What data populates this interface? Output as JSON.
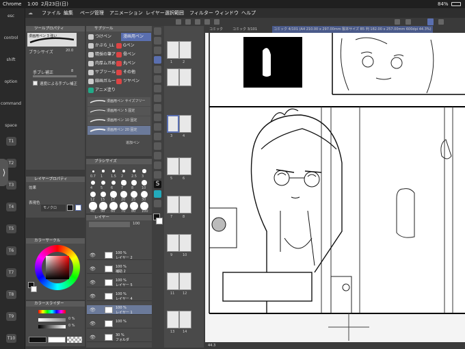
{
  "status": {
    "app": "Chrome",
    "time": "1:00",
    "date": "2月23日(日)",
    "battery": "84%"
  },
  "menu": [
    "ファイル",
    "編集",
    "ページ管理",
    "アニメーション",
    "レイヤー",
    "選択範囲",
    "フィルター",
    "ウィンドウ",
    "ヘルプ"
  ],
  "sidebar": {
    "keys": [
      "esc",
      "control",
      "shift",
      "option",
      "command",
      "space"
    ],
    "tbuttons": [
      "T1",
      "T2",
      "T3",
      "T4",
      "T5",
      "T6",
      "T7",
      "T8",
      "T9",
      "T10"
    ]
  },
  "tool_property": {
    "title": "ツールプロパティ",
    "tool_name": "漫画用ペン 3 強い",
    "brush_size_label": "ブラシサイズ",
    "brush_size_value": "20.0",
    "stabilization_label": "手ブレ補正",
    "stabilization_value": "8",
    "speed_label": "速度による手ブレ補正"
  },
  "layer_property": {
    "title": "レイヤープロパティ",
    "effect_label": "効果",
    "expression_label": "表現色",
    "expression_value": "モノクロ"
  },
  "color_circle": {
    "title": "カラーサークル"
  },
  "color_slider": {
    "title": "カラースライダー",
    "v1": "0 %",
    "v2": "0 %",
    "v3": "0 %"
  },
  "subtool": {
    "title": "サブツール",
    "groups": [
      {
        "left": "つけペン",
        "right": "漫画用ペン"
      },
      {
        "left": "かぶら_LL",
        "right": "Gペン"
      },
      {
        "left": "精採の筆ア",
        "right": "骨ペン"
      },
      {
        "left": "肉厚ムガめ",
        "right": "丸ペン"
      },
      {
        "left": "サブツール",
        "right": "その他"
      },
      {
        "left": "線画ガルー",
        "right": "ツヤペン"
      },
      {
        "left": "アニメ塗り",
        "right": ""
      }
    ],
    "brushes": [
      "漫画用ペン サイズフリー",
      "漫画用ペン 5 固定",
      "漫画用ペン 10 固定",
      "漫画用ペン 20 固定"
    ],
    "footer": "追加ペン"
  },
  "brush_size": {
    "title": "ブラシサイズ",
    "sizes": [
      "0.7",
      "1",
      "1.5",
      "2",
      "2.5",
      "3",
      "4",
      "5",
      "6",
      "7",
      "8",
      "10",
      "12",
      "15",
      "17",
      "20",
      "25",
      "30",
      "40",
      "50",
      "60",
      "70",
      "80",
      "100",
      "120",
      "150",
      "170",
      "200",
      "250",
      "300"
    ]
  },
  "layer": {
    "title": "レイヤー",
    "opacity": "100",
    "rows": [
      {
        "pct": "100 %",
        "name": "レイヤー 2"
      },
      {
        "pct": "100 %",
        "name": "補助 2"
      },
      {
        "pct": "100 %",
        "name": "レイヤー 5"
      },
      {
        "pct": "100 %",
        "name": "レイヤー 4"
      },
      {
        "pct": "100 %",
        "name": "レイヤー 1"
      },
      {
        "pct": "100 %",
        "name": ""
      },
      {
        "pct": "30 %",
        "name": "フォルダ"
      }
    ]
  },
  "tabs": [
    "コミック",
    "コミック 3/101",
    "コミック 4/101 (A4 210.00 x 297.00mm 製本サイズ B5 判 182.00 x 257.00mm 600dpi 44.3%)"
  ],
  "pages": {
    "nums": [
      "1",
      "2",
      "3",
      "4",
      "5",
      "6",
      "7",
      "8",
      "9",
      "10",
      "11",
      "12",
      "13",
      "14"
    ]
  },
  "zoom": "44.3",
  "colors": {
    "accent": "#5a6fb0",
    "panel": "#4a4a4a"
  }
}
